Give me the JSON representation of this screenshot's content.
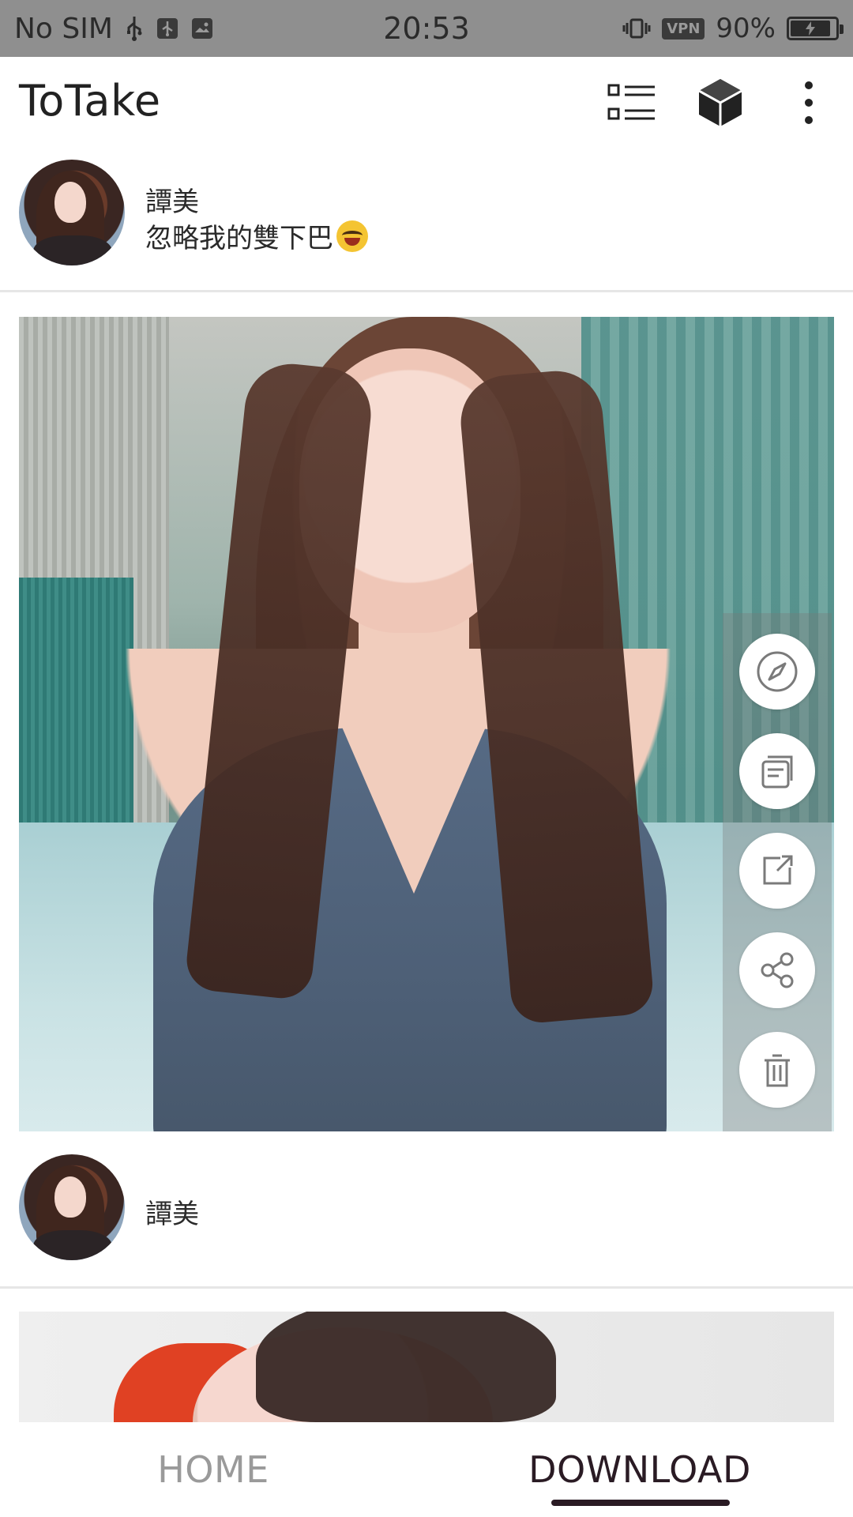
{
  "status_bar": {
    "carrier": "No SIM",
    "time": "20:53",
    "vpn": "VPN",
    "battery_pct_label": "90%",
    "battery_level": 0.9,
    "icons": [
      "usb-icon",
      "usb-settings-icon",
      "image-notification-icon",
      "vibrate-icon",
      "vpn-icon",
      "battery-icon"
    ]
  },
  "app_bar": {
    "title": "ToTake",
    "actions": [
      "checklist-icon",
      "cube-icon",
      "overflow-menu-icon"
    ]
  },
  "posts": [
    {
      "name": "譚美",
      "caption": "忽略我的雙下巴",
      "caption_emoji": "rolling-on-floor-laughing-emoji"
    },
    {
      "name": "譚美"
    }
  ],
  "media_actions": [
    "compass-icon",
    "copy-icon",
    "open-external-icon",
    "share-icon",
    "trash-icon"
  ],
  "bottom_tabs": {
    "home": "HOME",
    "download": "DOWNLOAD",
    "selected": "DOWNLOAD"
  },
  "colors": {
    "status_bar_bg": "#8f8f8f",
    "tab_selected": "#2a1b24",
    "tab_unselected": "#9a9a9a"
  }
}
